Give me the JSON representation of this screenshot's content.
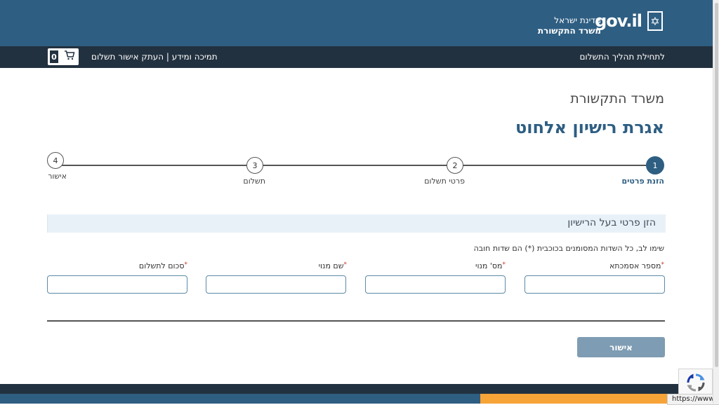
{
  "header": {
    "logo_text": "gov.il",
    "state_name": "מדינת ישראל",
    "ministry_name": "משרד התקשורת"
  },
  "nav": {
    "start_payment": "לתחילת תהליך התשלום",
    "support": "תמיכה ומידע",
    "separator": "|",
    "copy_receipt": "העתק אישור תשלום",
    "cart_count": "0"
  },
  "page": {
    "subtitle": "משרד התקשורת",
    "title": "אגרת רישיון אלחוט"
  },
  "steps": [
    {
      "number": "1",
      "label": "הזנת פרטים",
      "active": true
    },
    {
      "number": "2",
      "label": "פרטי תשלום",
      "active": false
    },
    {
      "number": "3",
      "label": "תשלום",
      "active": false
    },
    {
      "number": "4",
      "label": "אישור",
      "active": false
    }
  ],
  "form": {
    "section_title": "הזן פרטי בעל הרישיון",
    "required_note": "שימו לב, כל השדות המסומנים בכוכבית (*) הם שדות חובה",
    "required_mark": "*",
    "fields": {
      "reference": {
        "label": "מספר אסמכתא",
        "value": ""
      },
      "subscriber_no": {
        "label": "מס' מנוי",
        "value": ""
      },
      "subscriber_name": {
        "label": "שם מנוי",
        "value": ""
      },
      "amount": {
        "label": "סכום לתשלום",
        "value": ""
      }
    },
    "submit_label": "אישור"
  },
  "status": {
    "url": "https://www.gov.il"
  },
  "colors": {
    "brand": "#2e5e82",
    "dark_nav": "#22313f",
    "accent_orange": "#f6a338"
  }
}
